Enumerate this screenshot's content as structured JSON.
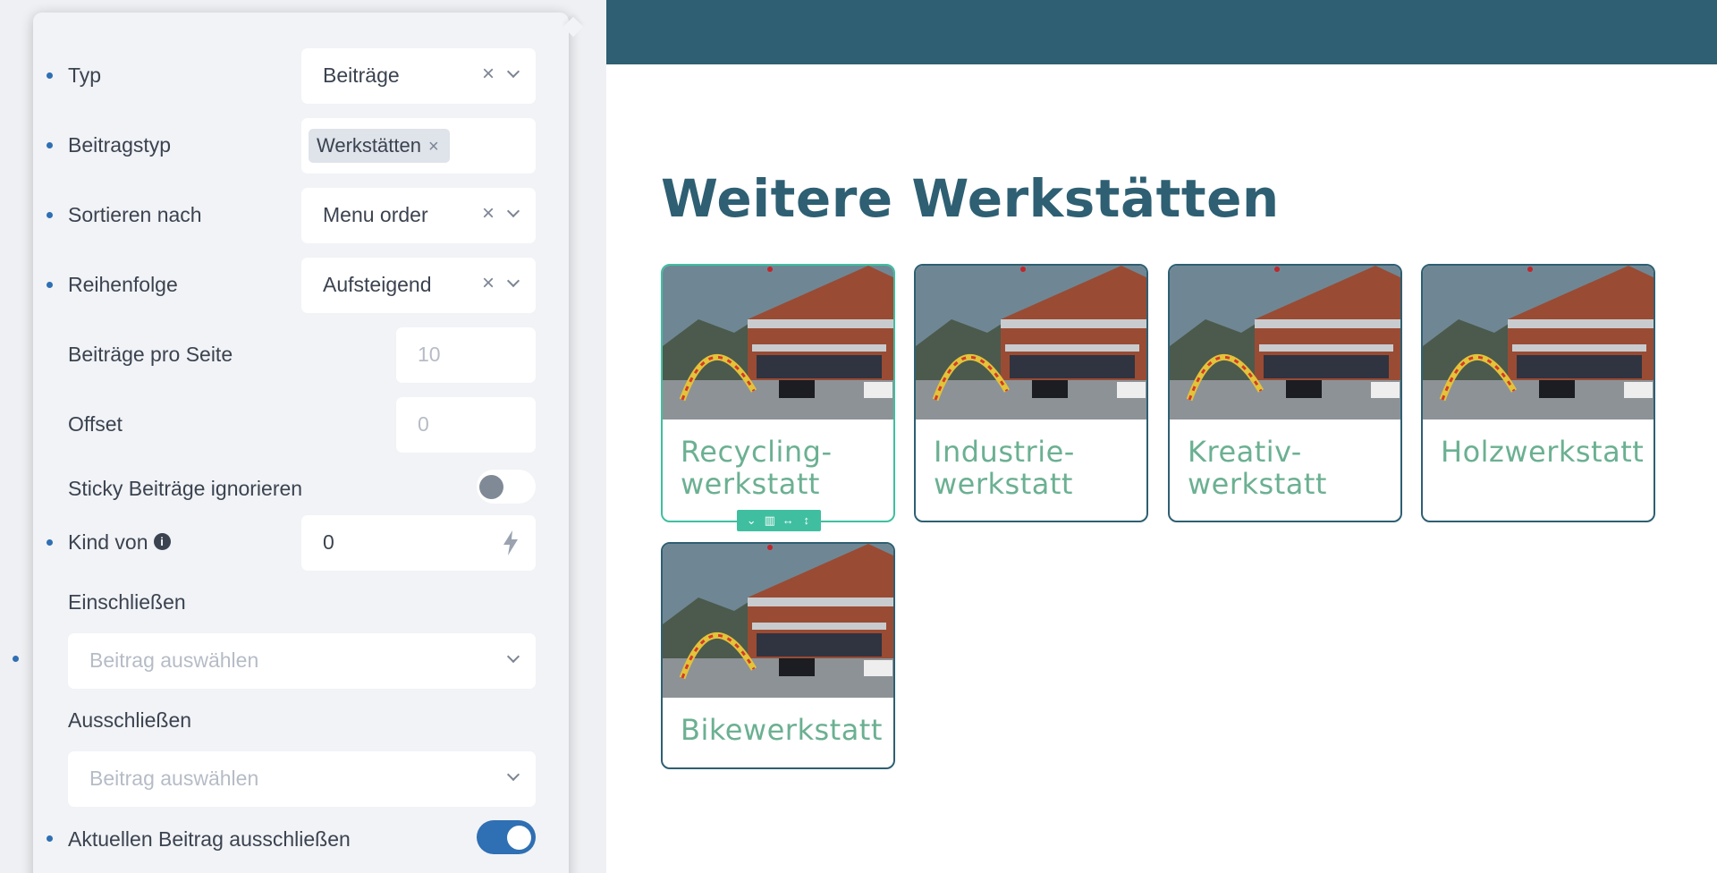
{
  "settings": {
    "typ": {
      "label": "Typ",
      "value": "Beiträge",
      "clear": "×"
    },
    "beitragstyp": {
      "label": "Beitragstyp",
      "tag": "Werkstätten",
      "tag_remove": "×"
    },
    "sortieren": {
      "label": "Sortieren nach",
      "value": "Menu order",
      "clear": "×"
    },
    "reihenfolge": {
      "label": "Reihenfolge",
      "value": "Aufsteigend",
      "clear": "×"
    },
    "pro_seite": {
      "label": "Beiträge pro Seite",
      "placeholder": "10"
    },
    "offset": {
      "label": "Offset",
      "placeholder": "0"
    },
    "sticky": {
      "label": "Sticky Beiträge ignorieren",
      "enabled": false
    },
    "kind_von": {
      "label": "Kind von",
      "info_icon": "i",
      "value": "0"
    },
    "einschliessen": {
      "label": "Einschließen",
      "placeholder": "Beitrag auswählen"
    },
    "ausschliessen": {
      "label": "Ausschließen",
      "placeholder": "Beitrag auswählen"
    },
    "aktuell": {
      "label": "Aktuellen Beitrag ausschließen",
      "enabled": true
    }
  },
  "preview": {
    "title": "Weitere Werkstätten",
    "cards": [
      {
        "title": "Recycling-\nwerkstatt"
      },
      {
        "title": "Industrie-\nwerkstatt"
      },
      {
        "title": "Kreativ-\nwerkstatt"
      },
      {
        "title": "Holzwerkstatt"
      },
      {
        "title": "Bikewerkstatt"
      }
    ]
  },
  "colors": {
    "accent_blue": "#2f6fb3",
    "header_teal": "#2e5f72",
    "card_title_green": "#6bb092",
    "selection_green": "#3fbfa0"
  }
}
